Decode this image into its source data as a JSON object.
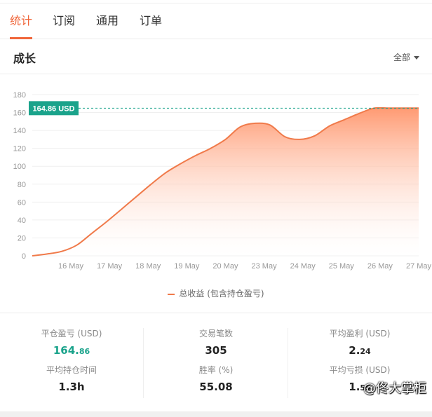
{
  "tabs": [
    {
      "label": "统计",
      "active": true
    },
    {
      "label": "订阅",
      "active": false
    },
    {
      "label": "通用",
      "active": false
    },
    {
      "label": "订单",
      "active": false
    }
  ],
  "section": {
    "title": "成长",
    "filter_label": "全部"
  },
  "chart_data": {
    "type": "area",
    "x_labels": [
      "16 May",
      "17 May",
      "18 May",
      "19 May",
      "20 May",
      "23 May",
      "24 May",
      "25 May",
      "26 May",
      "27 May"
    ],
    "y_ticks": [
      0,
      20,
      40,
      60,
      80,
      100,
      120,
      140,
      160,
      180
    ],
    "ylim": [
      0,
      180
    ],
    "series": [
      {
        "name": "总收益 (包含持仓盈亏)",
        "values": [
          0,
          2,
          5,
          12,
          25,
          38,
          52,
          66,
          80,
          93,
          103,
          112,
          120,
          130,
          144,
          148,
          146,
          133,
          130,
          134,
          145,
          152,
          159,
          164.86,
          164.86,
          164.86,
          164.86
        ]
      }
    ],
    "reference_label": "164.86 USD",
    "reference_value": 164.86,
    "grid": true,
    "legend_position": "bottom-center",
    "colors": {
      "line": "#f07a4a",
      "fill_top": "#ff9a72",
      "reference": "#1aa38b"
    }
  },
  "stats": [
    {
      "label": "平仓盈亏 (USD)",
      "value_main": "164.",
      "value_small": "86"
    },
    {
      "label": "交易笔数",
      "value_main": "305",
      "value_small": ""
    },
    {
      "label": "平均盈利 (USD)",
      "value_main": "2.",
      "value_small": "24"
    },
    {
      "label": "平均持仓时间",
      "value_main": "1.3h",
      "value_small": ""
    },
    {
      "label": "胜率 (%)",
      "value_main": "55.08",
      "value_small": ""
    },
    {
      "label": "平均亏损 (USD)",
      "value_main": "1.",
      "value_small": "55"
    }
  ],
  "watermark": "@佟大掌柜",
  "colors": {
    "accent": "#f0663a",
    "positive": "#1aa38b"
  }
}
